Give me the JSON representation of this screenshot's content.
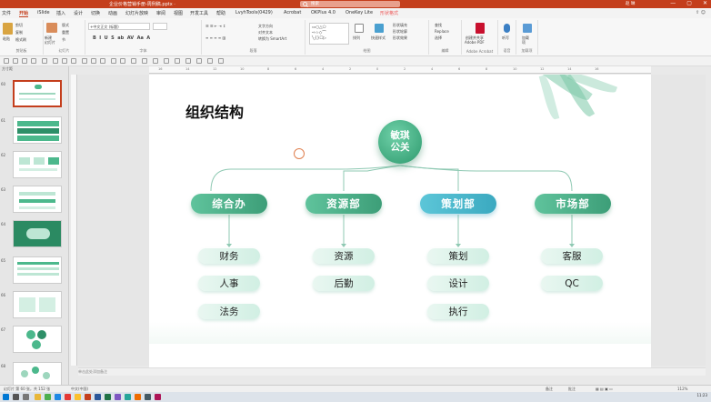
{
  "window": {
    "doc_title": "企业价格营销手册-周例稿.pptx ·",
    "search_placeholder": "搜索",
    "user": "赵 琳",
    "min": "—",
    "max": "▢",
    "close": "✕"
  },
  "tabs": [
    "文件",
    "开始",
    "iSlide",
    "插入",
    "设计",
    "切换",
    "动画",
    "幻灯片放映",
    "审阅",
    "视图",
    "开发工具",
    "帮助",
    "LvyhTools(0429)",
    "Acrobat",
    "OKPlus 4.0",
    "OneKey Lite",
    "形状格式"
  ],
  "active_tab": "开始",
  "ribbon": {
    "groups": [
      "剪贴板",
      "幻灯片",
      "字体",
      "段落",
      "绘图",
      "编辑",
      "Adobe Acrobat",
      "语音",
      "加载项"
    ],
    "paste": "粘贴",
    "cut": "剪切",
    "copy": "复制",
    "format_painter": "格式刷",
    "new_slide": "新建\n幻灯片",
    "reuse": "重用\n幻灯片",
    "layout": "版式",
    "reset": "重置",
    "section": "节",
    "font_placeholder": "+中文正文 (标题)",
    "text_direction": "文字方向",
    "align_text": "对齐文本",
    "smartart": "转换为 SmartArt",
    "arrange": "排列",
    "quick_styles": "快速样式",
    "shape_fill": "形状填充",
    "shape_outline": "形状轮廓",
    "shape_effects": "形状效果",
    "find": "查找",
    "replace": "Replace",
    "select": "选择",
    "create_pdf": "创建并共享\nAdobe PDF",
    "dictate": "听写",
    "addins": "加载\n项"
  },
  "left_panel": {
    "size_label": "方寸距",
    "slide_numbers": [
      "60",
      "61",
      "62",
      "63",
      "64",
      "65",
      "66",
      "67",
      "68"
    ]
  },
  "slide": {
    "title": "组织结构",
    "root": "敏琪\n公关",
    "departments": [
      {
        "name": "综合办",
        "style": "green",
        "children": [
          "财务",
          "人事",
          "法务"
        ]
      },
      {
        "name": "资源部",
        "style": "green",
        "children": [
          "资源",
          "后勤"
        ]
      },
      {
        "name": "策划部",
        "style": "blue",
        "children": [
          "策划",
          "设计",
          "执行"
        ]
      },
      {
        "name": "市场部",
        "style": "green",
        "children": [
          "客服",
          "QC"
        ]
      }
    ],
    "colors": {
      "green": "#4fb58a",
      "blue": "#4bb8cf",
      "line": "#8fc9b3"
    }
  },
  "notes_placeholder": "单击此处添加备注",
  "status": {
    "left": "幻灯片 第 60 张，共 152 张",
    "lang": "中文(中国)",
    "notes": "备注",
    "comments": "批注",
    "zoom": "112%"
  },
  "taskbar": {
    "time": "11:23"
  }
}
